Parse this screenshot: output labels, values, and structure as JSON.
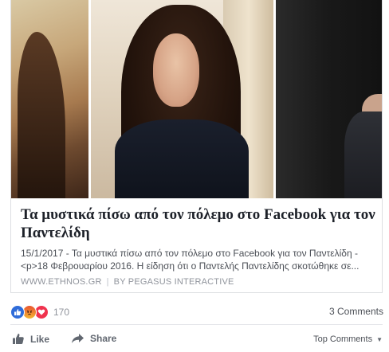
{
  "post": {
    "title": "Τα μυστικά πίσω από τον πόλεμο στο Facebook για τον Παντελίδη",
    "description_line1": "15/1/2017 - Τα μυστικά πίσω από τον πόλεμο στο Facebook για τον Παντελίδη -",
    "description_line2": "<p>18 Φεβρουαρίου 2016. Η είδηση ότι ο Παντελής Παντελίδης σκοτώθηκε σε...",
    "source_domain": "WWW.ETHNOS.GR",
    "separator": "|",
    "source_author": "BY PEGASUS INTERACTIVE"
  },
  "reactions": {
    "icons": [
      "like-icon",
      "angry-icon",
      "love-icon"
    ],
    "count": "170"
  },
  "comments": {
    "count_label": "3 Comments"
  },
  "actions": {
    "like_label": "Like",
    "share_label": "Share",
    "sort_label": "Top Comments"
  },
  "colors": {
    "like_blue": "#2f6cd9",
    "love_red": "#f0334e",
    "muted_text": "#90949c"
  }
}
